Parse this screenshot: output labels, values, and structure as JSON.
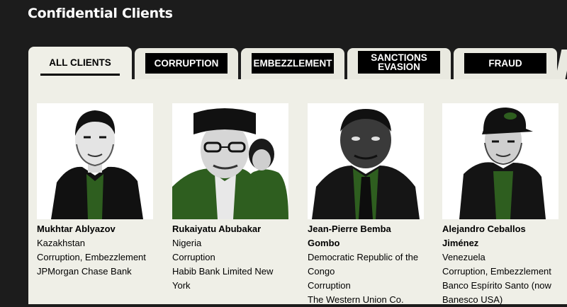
{
  "page": {
    "title": "Confidential Clients"
  },
  "tabs": [
    {
      "label": "ALL CLIENTS",
      "active": true
    },
    {
      "label": "CORRUPTION",
      "active": false
    },
    {
      "label": "EMBEZZLEMENT",
      "active": false
    },
    {
      "label": "SANCTIONS EVASION",
      "active": false
    },
    {
      "label": "FRAUD",
      "active": false
    }
  ],
  "colors": {
    "accent_green": "#2e5e1f",
    "background": "#1c1c1c",
    "panel": "#efefe7"
  },
  "clients": [
    {
      "name": "Mukhtar Ablyazov",
      "country": "Kazakhstan",
      "crimes": "Corruption, Embezzlement",
      "bank": "JPMorgan Chase Bank"
    },
    {
      "name": "Rukaiyatu Abubakar",
      "country": "Nigeria",
      "crimes": "Corruption",
      "bank": "Habib Bank Limited New York"
    },
    {
      "name": "Jean-Pierre Bemba Gombo",
      "country": "Democratic Republic of the Congo",
      "crimes": "Corruption",
      "bank": "The Western Union Co."
    },
    {
      "name": "Alejandro Ceballos Jiménez",
      "country": "Venezuela",
      "crimes": "Corruption, Embezzlement",
      "bank": "Banco Espírito Santo (now Banesco USA)"
    }
  ]
}
